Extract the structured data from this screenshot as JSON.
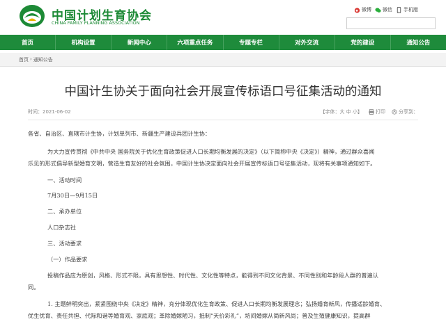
{
  "header": {
    "site_title": "中国计划生育协会",
    "site_subtitle": "CHINA FAMILY PLANNING ASSOCIATION",
    "social": [
      {
        "icon": "weibo-icon",
        "label": "微博"
      },
      {
        "icon": "wechat-icon",
        "label": "微信"
      },
      {
        "icon": "mobile-icon",
        "label": "手机版"
      }
    ],
    "search": {
      "value": "",
      "placeholder": ""
    }
  },
  "nav": {
    "items": [
      "首页",
      "机构设置",
      "新闻中心",
      "六项重点任务",
      "专题专栏",
      "对外交流",
      "党的建设",
      "通知公告"
    ]
  },
  "breadcrumb": {
    "items": [
      "首页",
      "通知公告"
    ],
    "separator": "›"
  },
  "article": {
    "title": "中国计生协关于面向社会开展宣传标语口号征集活动的通知",
    "time": "时间：2021-06-02",
    "font_size": "【字体：大 中 小】",
    "print": "打印",
    "share": "分享到："
  },
  "content": {
    "salutation": "各省、自治区、直辖市计生协，计划单列市、新疆生产建设兵团计生协：",
    "intro_1": "为大力宣传贯彻《中共中央 国务院关于优化生育政策促进人口长期均衡发展的决定》（以下简称中央《决定》）精神，通过群众喜闻",
    "intro_2": "乐见的形式倡导新型婚育文明，营造生育友好的社会氛围，中国计生协决定面向社会开展宣传标语口号征集活动，现将有关事项通知如下。",
    "h1": "一、活动时间",
    "t1": "7月30日—9月15日",
    "h2": "二、承办单位",
    "t2": "人口杂志社",
    "h3": "三、活动要求",
    "h3_1": "（一）作品要求",
    "req_1": "投稿作品应为原创，风格、形式不限，具有思想性、时代性、文化性等特点，能得到不同文化背景、不同性别和年龄段人群的普遍认",
    "req_2": "同。",
    "p1_1": "1. 主题鲜明突出，紧紧围绕中央《决定》精神，充分体现优化生育政策、促进人口长期均衡发展理念；弘扬婚育新风，传播适龄婚育、",
    "p1_2": "优生优育、责任共担、代际和谐等婚育观、家庭观；革除婚嫁陋习，抵制“天价彩礼”，坊间婚嫁从简新风尚；普及生殖健康知识，提高群"
  },
  "colors": {
    "brand_green": "#1e8b3b",
    "logo_green": "#1d8a36"
  }
}
